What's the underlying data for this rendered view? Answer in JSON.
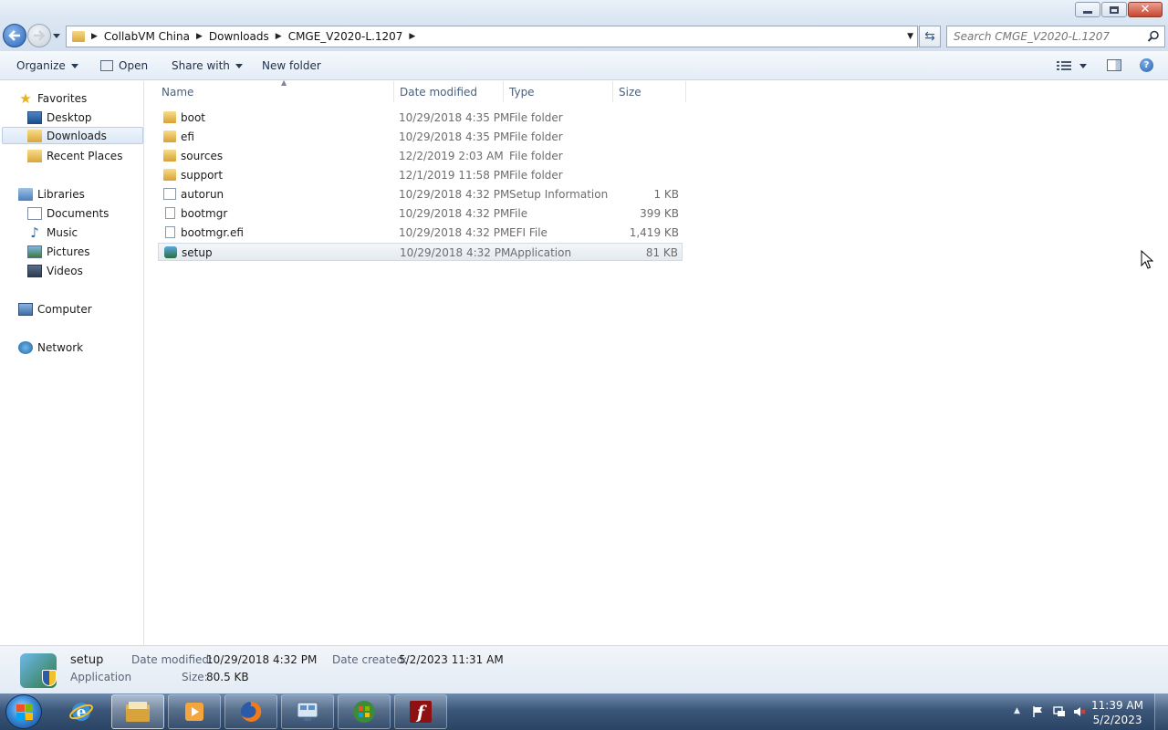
{
  "window": {
    "breadcrumb": [
      "CollabVM China",
      "Downloads",
      "CMGE_V2020-L.1207"
    ],
    "search_placeholder": "Search CMGE_V2020-L.1207"
  },
  "toolbar": {
    "organize": "Organize",
    "open": "Open",
    "share_with": "Share with",
    "new_folder": "New folder"
  },
  "navpane": {
    "favorites": "Favorites",
    "desktop": "Desktop",
    "downloads": "Downloads",
    "recent_places": "Recent Places",
    "libraries": "Libraries",
    "documents": "Documents",
    "music": "Music",
    "pictures": "Pictures",
    "videos": "Videos",
    "computer": "Computer",
    "network": "Network"
  },
  "columns": {
    "name": "Name",
    "date_modified": "Date modified",
    "type": "Type",
    "size": "Size"
  },
  "files": [
    {
      "name": "boot",
      "date": "10/29/2018 4:35 PM",
      "type": "File folder",
      "size": "",
      "icon": "folder-icon"
    },
    {
      "name": "efi",
      "date": "10/29/2018 4:35 PM",
      "type": "File folder",
      "size": "",
      "icon": "folder-icon"
    },
    {
      "name": "sources",
      "date": "12/2/2019 2:03 AM",
      "type": "File folder",
      "size": "",
      "icon": "folder-icon"
    },
    {
      "name": "support",
      "date": "12/1/2019 11:58 PM",
      "type": "File folder",
      "size": "",
      "icon": "folder-icon"
    },
    {
      "name": "autorun",
      "date": "10/29/2018 4:32 PM",
      "type": "Setup Information",
      "size": "1 KB",
      "icon": "setup-info-icon"
    },
    {
      "name": "bootmgr",
      "date": "10/29/2018 4:32 PM",
      "type": "File",
      "size": "399 KB",
      "icon": "file-icon"
    },
    {
      "name": "bootmgr.efi",
      "date": "10/29/2018 4:32 PM",
      "type": "EFI File",
      "size": "1,419 KB",
      "icon": "file-icon"
    },
    {
      "name": "setup",
      "date": "10/29/2018 4:32 PM",
      "type": "Application",
      "size": "81 KB",
      "icon": "setup-app-icon",
      "selected": true
    }
  ],
  "details": {
    "name": "setup",
    "type": "Application",
    "date_modified_label": "Date modified:",
    "date_modified": "10/29/2018 4:32 PM",
    "date_created_label": "Date created:",
    "date_created": "5/2/2023 11:31 AM",
    "size_label": "Size:",
    "size": "80.5 KB"
  },
  "taskbar": {
    "items": [
      "internet-explorer-icon",
      "windows-explorer-icon",
      "media-player-icon",
      "firefox-icon",
      "remote-desktop-icon",
      "windows-logo-app-icon",
      "flash-icon"
    ],
    "time": "11:39 AM",
    "date": "5/2/2023"
  },
  "colors": {
    "selection_bg": "#e4eaf0",
    "folder_yellow": "#d8a233",
    "taskbar_blue": "#2a4465"
  }
}
